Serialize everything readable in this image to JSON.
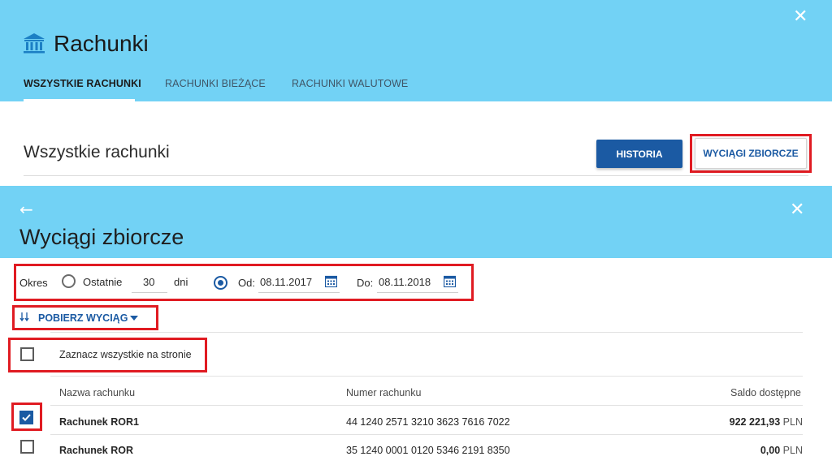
{
  "header": {
    "title": "Rachunki",
    "tabs": [
      {
        "label": "WSZYSTKIE RACHUNKI",
        "active": true
      },
      {
        "label": "RACHUNKI BIEŻĄCE",
        "active": false
      },
      {
        "label": "RACHUNKI WALUTOWE",
        "active": false
      }
    ],
    "close_icon": "close-icon"
  },
  "section": {
    "title": "Wszystkie rachunki",
    "history_button": "HISTORIA",
    "statements_button": "WYCIĄGI ZBIORCZE"
  },
  "panel": {
    "title": "Wyciągi zbiorcze",
    "back_icon": "arrow-left-icon",
    "close_icon": "close-icon"
  },
  "filter": {
    "period_label": "Okres",
    "last_label": "Ostatnie",
    "last_days_value": "30",
    "days_label": "dni",
    "from_label": "Od:",
    "from_value": "08.11.2017",
    "to_label": "Do:",
    "to_value": "08.11.2018",
    "selected_option": "date-range"
  },
  "download": {
    "label": "POBIERZ WYCIĄG"
  },
  "select_all": {
    "label": "Zaznacz wszystkie na stronie",
    "checked": false
  },
  "table": {
    "columns": [
      "Nazwa rachunku",
      "Numer rachunku",
      "Saldo dostępne"
    ],
    "rows": [
      {
        "name": "Rachunek ROR1",
        "number": "44 1240 2571 3210 3623 7616 7022",
        "balance": "922 221,93",
        "currency": "PLN",
        "checked": true
      },
      {
        "name": "Rachunek ROR",
        "number": "35 1240 0001 0120 5346 2191 8350",
        "balance": "0,00",
        "currency": "PLN",
        "checked": false
      }
    ]
  },
  "colors": {
    "header_bg": "#72d2f5",
    "primary": "#1b5aa3",
    "highlight": "#e01b22"
  }
}
